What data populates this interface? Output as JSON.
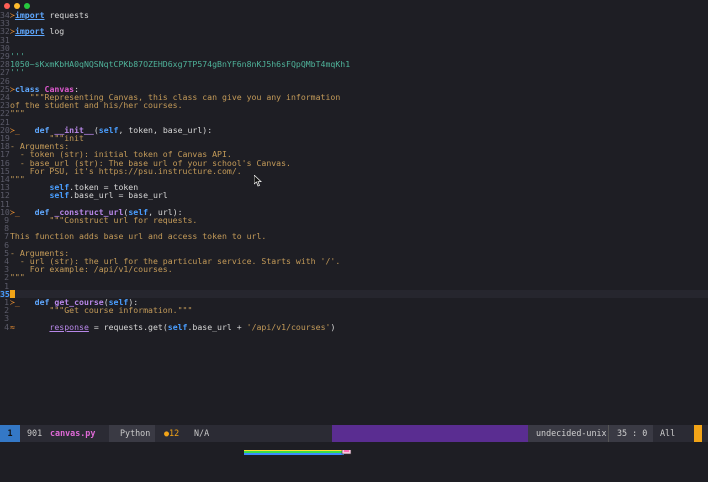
{
  "editor": {
    "file_lines": [
      {
        "n": "34",
        "t": [
          [
            "≻",
            "mk"
          ],
          [
            "import",
            "k u"
          ],
          [
            " requests",
            ""
          ]
        ]
      },
      {
        "n": "33",
        "t": [
          [
            "",
            ""
          ]
        ]
      },
      {
        "n": "32",
        "t": [
          [
            "≻",
            "mk"
          ],
          [
            "import",
            "k u"
          ],
          [
            " log",
            ""
          ]
        ]
      },
      {
        "n": "31",
        "t": [
          [
            "",
            ""
          ]
        ]
      },
      {
        "n": "30",
        "t": [
          [
            "",
            ""
          ]
        ]
      },
      {
        "n": "29",
        "t": [
          [
            "'''",
            "s"
          ]
        ]
      },
      {
        "n": "28",
        "t": [
          [
            "1050~sKxmKbHA0qNQSNqtCPKb87OZEHD6xg7TP574gBnYF6n8nKJ5h6sFQpQMbT4mqKh1",
            "s"
          ]
        ]
      },
      {
        "n": "27",
        "t": [
          [
            "'''",
            "s"
          ]
        ]
      },
      {
        "n": "26",
        "t": [
          [
            "",
            ""
          ]
        ]
      },
      {
        "n": "25",
        "t": [
          [
            "≻",
            "mk"
          ],
          [
            "class",
            "k"
          ],
          [
            " ",
            ""
          ],
          [
            "Canvas",
            "cls"
          ],
          [
            ":",
            ""
          ]
        ]
      },
      {
        "n": "24",
        "t": [
          [
            "    \"\"\"Representing Canvas, this class can give you any information",
            "doc"
          ]
        ]
      },
      {
        "n": "23",
        "t": [
          [
            "of the student and his/her courses.",
            "doc"
          ]
        ]
      },
      {
        "n": "22",
        "t": [
          [
            "\"\"\"",
            "doc"
          ]
        ]
      },
      {
        "n": "21",
        "t": [
          [
            "",
            ""
          ]
        ]
      },
      {
        "n": "20",
        "t": [
          [
            "≻_",
            "mk"
          ],
          [
            "   ",
            ""
          ],
          [
            "def",
            "k"
          ],
          [
            " ",
            ""
          ],
          [
            "__init__",
            "fn"
          ],
          [
            "(",
            ""
          ],
          [
            "self",
            "sf"
          ],
          [
            ", token, base_url):",
            ""
          ]
        ]
      },
      {
        "n": "19",
        "t": [
          [
            "        \"\"\"init",
            "doc"
          ]
        ]
      },
      {
        "n": "18",
        "t": [
          [
            "- Arguments:",
            "doc"
          ]
        ]
      },
      {
        "n": "17",
        "t": [
          [
            "  - token (str): initial token of Canvas API.",
            "doc"
          ]
        ]
      },
      {
        "n": "16",
        "t": [
          [
            "  - base_url (str): The base url of your school's Canvas.",
            "doc"
          ]
        ]
      },
      {
        "n": "15",
        "t": [
          [
            "    For PSU, it's https://psu.instructure.com/.",
            "doc"
          ]
        ]
      },
      {
        "n": "14",
        "t": [
          [
            "\"\"\"",
            "doc"
          ]
        ]
      },
      {
        "n": "13",
        "t": [
          [
            "        ",
            ""
          ],
          [
            "self",
            "sf"
          ],
          [
            ".token = token",
            ""
          ]
        ]
      },
      {
        "n": "12",
        "t": [
          [
            "        ",
            ""
          ],
          [
            "self",
            "sf"
          ],
          [
            ".base_url = base_url",
            ""
          ]
        ]
      },
      {
        "n": "11",
        "t": [
          [
            "",
            ""
          ]
        ]
      },
      {
        "n": "10",
        "t": [
          [
            "≻_",
            "mk"
          ],
          [
            "   ",
            ""
          ],
          [
            "def",
            "k"
          ],
          [
            " ",
            ""
          ],
          [
            "_construct_url",
            "fn"
          ],
          [
            "(",
            ""
          ],
          [
            "self",
            "sf"
          ],
          [
            ", url):",
            ""
          ]
        ]
      },
      {
        "n": "9",
        "t": [
          [
            "        \"\"\"Construct url for requests.",
            "doc"
          ]
        ]
      },
      {
        "n": "8",
        "t": [
          [
            "",
            ""
          ]
        ]
      },
      {
        "n": "7",
        "t": [
          [
            "This function adds base url and access token to url.",
            "doc"
          ]
        ]
      },
      {
        "n": "6",
        "t": [
          [
            "",
            ""
          ]
        ]
      },
      {
        "n": "5",
        "t": [
          [
            "- Arguments:",
            "doc"
          ]
        ]
      },
      {
        "n": "4",
        "t": [
          [
            "  - url (str): the url for the particular service. Starts with '/'.",
            "doc"
          ]
        ]
      },
      {
        "n": "3",
        "t": [
          [
            "    For example: /api/v1/courses.",
            "doc"
          ]
        ]
      },
      {
        "n": "2",
        "t": [
          [
            "\"\"\"",
            "doc"
          ]
        ]
      },
      {
        "n": "1",
        "t": [
          [
            "",
            ""
          ]
        ]
      },
      {
        "n": "35",
        "cur": true,
        "t": [
          [
            "",
            ""
          ]
        ]
      },
      {
        "n": "1",
        "t": [
          [
            "≻_",
            "mk"
          ],
          [
            "   ",
            ""
          ],
          [
            "def",
            "k"
          ],
          [
            " ",
            ""
          ],
          [
            "get_course",
            "fn"
          ],
          [
            "(",
            ""
          ],
          [
            "self",
            "sf"
          ],
          [
            "):",
            ""
          ]
        ]
      },
      {
        "n": "2",
        "t": [
          [
            "        \"\"\"Get course information.\"\"\"",
            "doc"
          ]
        ]
      },
      {
        "n": "3",
        "t": [
          [
            "",
            ""
          ]
        ]
      },
      {
        "n": "4",
        "t": [
          [
            "≈",
            "mk"
          ],
          [
            "       ",
            ""
          ],
          [
            "response",
            "ul"
          ],
          [
            " = requests.get(",
            ""
          ],
          [
            "self",
            "sf"
          ],
          [
            ".base_url + ",
            ""
          ],
          [
            "'/api/v1/courses'",
            "doc"
          ],
          [
            ")",
            ""
          ]
        ]
      }
    ]
  },
  "status": {
    "window": "1",
    "size": "901",
    "filename": "canvas.py",
    "lang": "Python",
    "warnings": "●12",
    "na": "N/A",
    "encoding": "undecided-unix",
    "position": "35 : 0",
    "scroll": "All"
  },
  "colors": {
    "accent": "#5a2d91",
    "highlight": "#3478c6",
    "cursor": "#f2a417"
  }
}
